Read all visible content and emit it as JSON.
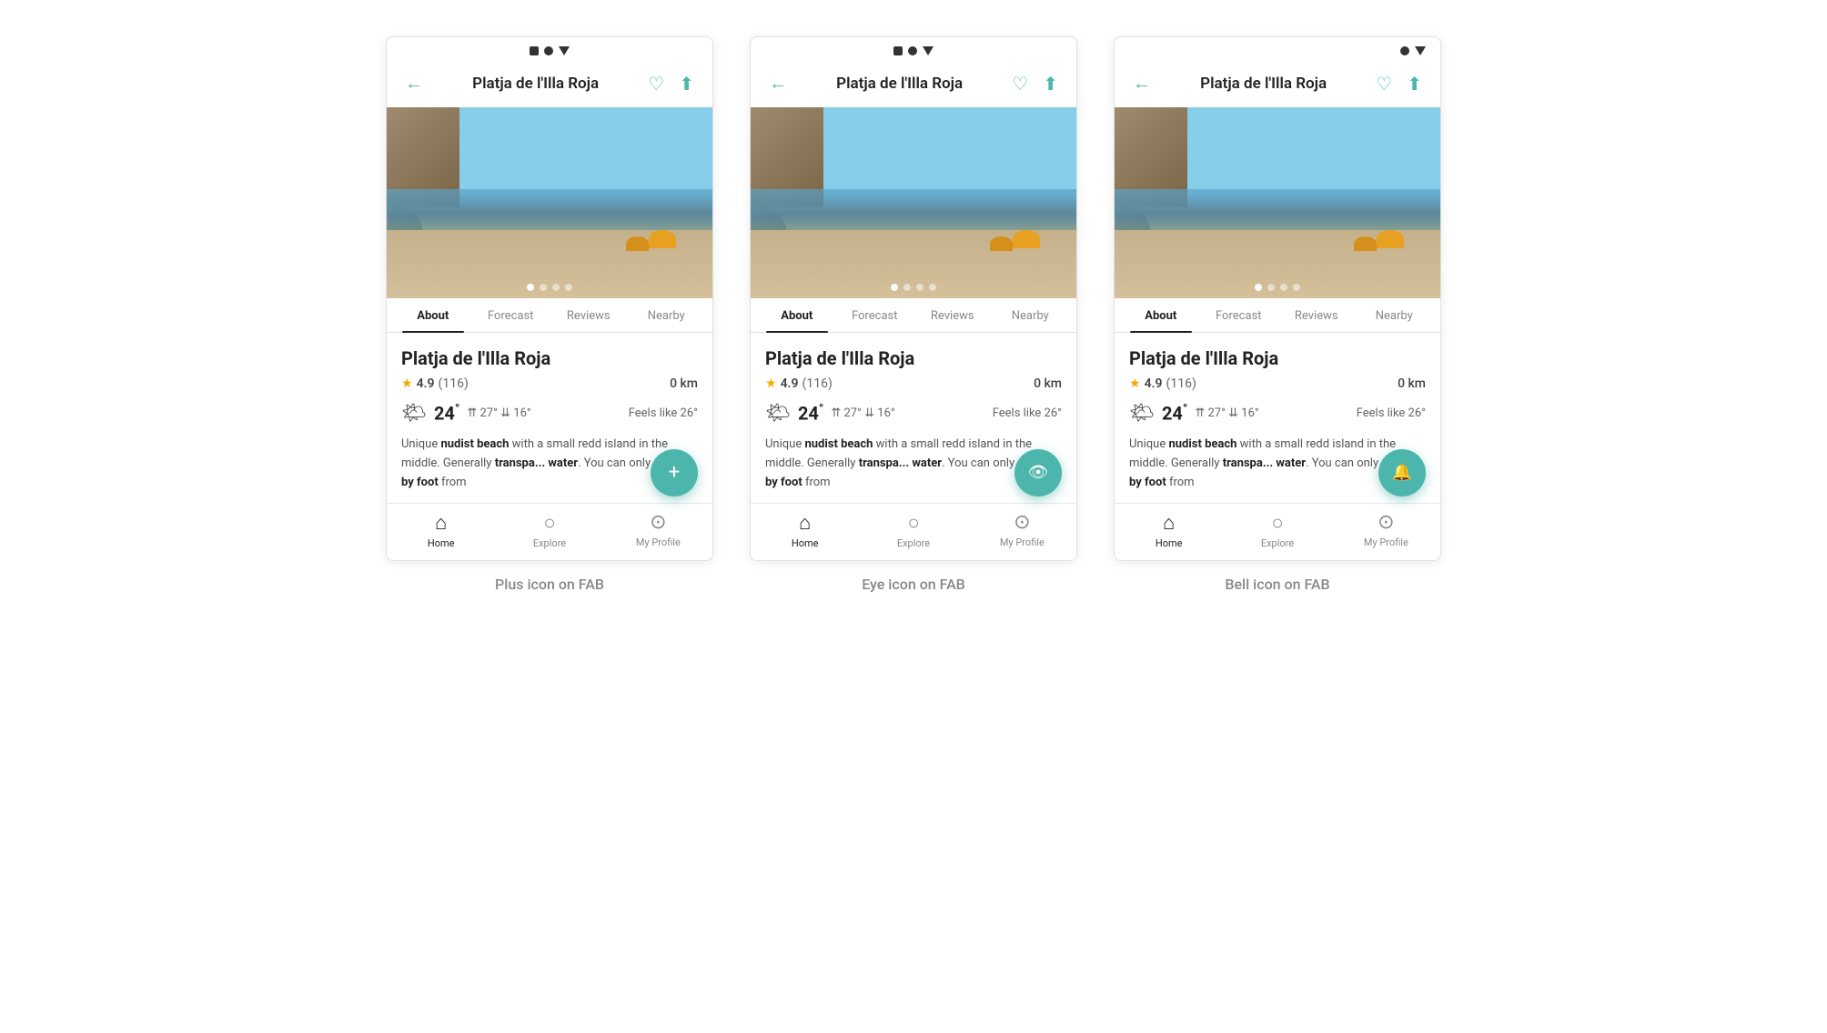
{
  "screens": [
    {
      "id": "plus-fab",
      "caption": "Plus icon on FAB",
      "fab_icon": "+",
      "fab_type": "plus"
    },
    {
      "id": "eye-fab",
      "caption": "Eye icon on FAB",
      "fab_icon": "👁",
      "fab_type": "eye"
    },
    {
      "id": "bell-fab",
      "caption": "Bell icon on FAB",
      "fab_icon": "🔔",
      "fab_type": "bell"
    }
  ],
  "shared": {
    "app_title": "Platja de l'Illa Roja",
    "tabs": [
      "About",
      "Forecast",
      "Reviews",
      "Nearby"
    ],
    "active_tab": "About",
    "beach_name": "Platja de l'Illa Roja",
    "rating": "4.9",
    "review_count": "(116)",
    "distance": "0 km",
    "temp": "24",
    "temp_high": "27",
    "temp_low": "16",
    "feels_like": "Feels like 26°",
    "description_start": "Unique ",
    "description_bold1": "nudist beach",
    "description_mid1": " with a small redd island in the middle. Generally ",
    "description_bold2": "transpa... water",
    "description_mid2": ". You can only ",
    "description_bold3": "reach it by foot",
    "description_end": " from",
    "nav_items": [
      {
        "label": "Home",
        "active": true
      },
      {
        "label": "Explore",
        "active": false
      },
      {
        "label": "My Profile",
        "active": false
      }
    ],
    "carousel_dots": 4,
    "active_dot": 0
  }
}
